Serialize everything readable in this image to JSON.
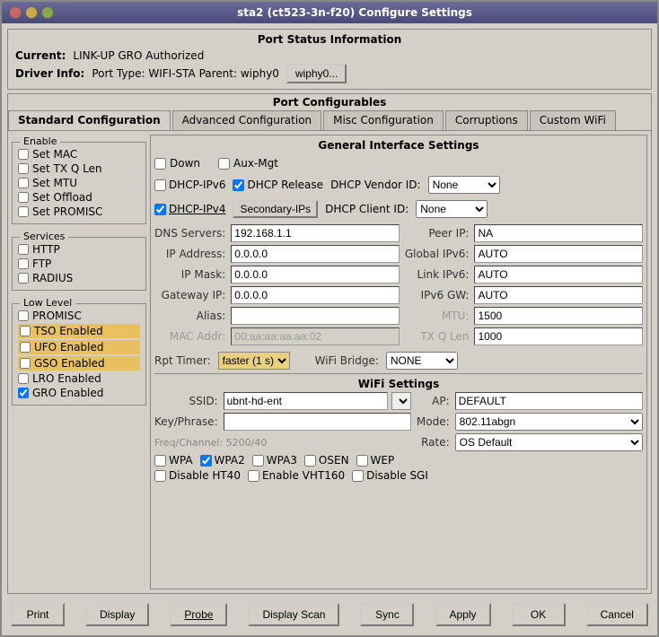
{
  "window": {
    "title": "sta2  (ct523-3n-f20) Configure Settings",
    "controls": [
      "close",
      "minimize",
      "maximize"
    ]
  },
  "port_status": {
    "section_title": "Port Status Information",
    "current_label": "Current:",
    "current_value": "LINK-UP GRO  Authorized",
    "driver_label": "Driver Info:",
    "driver_value": "Port Type: WIFI-STA   Parent: wiphy0",
    "wiphy_button": "wiphy0..."
  },
  "port_configurables": {
    "title": "Port Configurables",
    "tabs": [
      {
        "label": "Standard Configuration",
        "active": true
      },
      {
        "label": "Advanced Configuration",
        "active": false
      },
      {
        "label": "Misc Configuration",
        "active": false
      },
      {
        "label": "Corruptions",
        "active": false
      },
      {
        "label": "Custom WiFi",
        "active": false
      }
    ]
  },
  "left_panel": {
    "enable_group": {
      "title": "Enable",
      "items": [
        {
          "label": "Set MAC",
          "checked": false
        },
        {
          "label": "Set TX Q Len",
          "checked": false
        },
        {
          "label": "Set MTU",
          "checked": false
        },
        {
          "label": "Set Offload",
          "checked": false
        },
        {
          "label": "Set PROMISC",
          "checked": false
        }
      ]
    },
    "services_group": {
      "title": "Services",
      "items": [
        {
          "label": "HTTP",
          "checked": false
        },
        {
          "label": "FTP",
          "checked": false
        },
        {
          "label": "RADIUS",
          "checked": false
        }
      ]
    },
    "low_level_group": {
      "title": "Low Level",
      "items": [
        {
          "label": "PROMISC",
          "checked": false,
          "highlighted": false
        },
        {
          "label": "TSO Enabled",
          "checked": false,
          "highlighted": true
        },
        {
          "label": "UFO Enabled",
          "checked": false,
          "highlighted": true
        },
        {
          "label": "GSO Enabled",
          "checked": false,
          "highlighted": true
        },
        {
          "label": "LRO Enabled",
          "checked": false,
          "highlighted": false
        },
        {
          "label": "GRO Enabled",
          "checked": true,
          "highlighted": false
        }
      ]
    }
  },
  "general_interface": {
    "title": "General Interface Settings",
    "down_label": "Down",
    "aux_mgt_label": "Aux-Mgt",
    "fields": {
      "dhcp_ipv6": {
        "label": "DHCP-IPv6",
        "checked": false
      },
      "dhcp_release": {
        "label": "DHCP Release",
        "checked": true
      },
      "dhcp_vendor_id_label": "DHCP Vendor ID:",
      "dhcp_vendor_id_value": "None",
      "dhcp_ipv4": {
        "label": "DHCP-IPv4",
        "checked": true
      },
      "secondary_ips_btn": "Secondary-IPs",
      "dhcp_client_id_label": "DHCP Client ID:",
      "dhcp_client_id_value": "None",
      "dns_servers_label": "DNS Servers:",
      "dns_servers_value": "192.168.1.1",
      "peer_ip_label": "Peer IP:",
      "peer_ip_value": "NA",
      "ip_address_label": "IP Address:",
      "ip_address_value": "0.0.0.0",
      "global_ipv6_label": "Global IPv6:",
      "global_ipv6_value": "AUTO",
      "ip_mask_label": "IP Mask:",
      "ip_mask_value": "0.0.0.0",
      "link_ipv6_label": "Link IPv6:",
      "link_ipv6_value": "AUTO",
      "gateway_ip_label": "Gateway IP:",
      "gateway_ip_value": "0.0.0.0",
      "ipv6_gw_label": "IPv6 GW:",
      "ipv6_gw_value": "AUTO",
      "alias_label": "Alias:",
      "alias_value": "",
      "mtu_label": "MTU:",
      "mtu_value": "1500",
      "mac_addr_label": "MAC Addr:",
      "mac_addr_value": "00:aa:aa:aa:aa:02",
      "tx_q_len_label": "TX Q Len",
      "tx_q_len_value": "1000",
      "rpt_timer_label": "Rpt Timer:",
      "rpt_timer_value": "faster  (1 s)",
      "wifi_bridge_label": "WiFi Bridge:",
      "wifi_bridge_value": "NONE"
    }
  },
  "wifi_settings": {
    "title": "WiFi Settings",
    "ssid_label": "SSID:",
    "ssid_value": "ubnt-hd-ent",
    "ap_label": "AP:",
    "ap_value": "DEFAULT",
    "key_phrase_label": "Key/Phrase:",
    "key_phrase_value": "",
    "mode_label": "Mode:",
    "mode_value": "802.11abgn",
    "freq_channel_label": "Freq/Channel: 5200/40",
    "rate_label": "Rate:",
    "rate_value": "OS Default",
    "wpa": {
      "label": "WPA",
      "checked": false
    },
    "wpa2": {
      "label": "WPA2",
      "checked": true
    },
    "wpa3": {
      "label": "WPA3",
      "checked": false
    },
    "osen": {
      "label": "OSEN",
      "checked": false
    },
    "wep": {
      "label": "WEP",
      "checked": false
    },
    "disable_ht40": {
      "label": "Disable HT40",
      "checked": false
    },
    "enable_vht160": {
      "label": "Enable VHT160",
      "checked": false
    },
    "disable_sgi": {
      "label": "Disable SGI",
      "checked": false
    }
  },
  "bottom_buttons": {
    "print": "Print",
    "display": "Display",
    "probe": "Probe",
    "display_scan": "Display Scan",
    "sync": "Sync",
    "apply": "Apply",
    "ok": "OK",
    "cancel": "Cancel"
  }
}
